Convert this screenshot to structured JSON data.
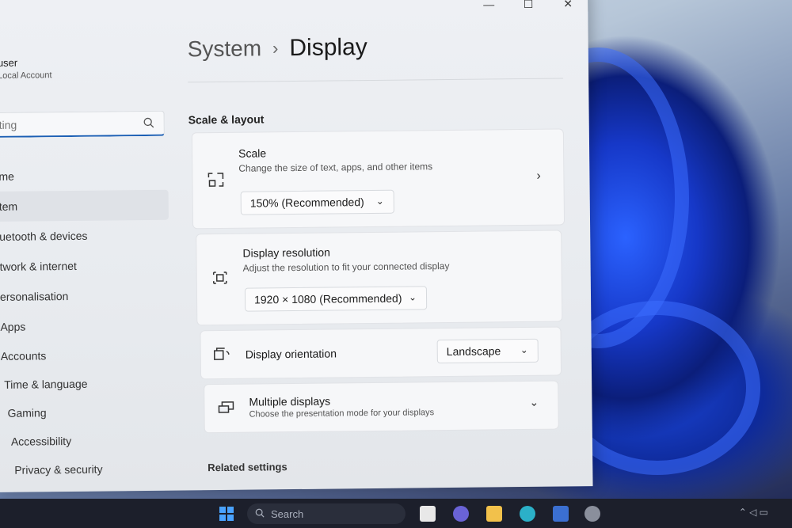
{
  "window": {
    "controls": {
      "minimize": "—",
      "maximize": "☐",
      "close": "✕"
    }
  },
  "user": {
    "name": "user",
    "account_type": "Local Account"
  },
  "search": {
    "placeholder": "ting"
  },
  "sidebar": {
    "items": [
      {
        "label": "me",
        "active": false
      },
      {
        "label": "tem",
        "active": true
      },
      {
        "label": "uetooth & devices",
        "active": false
      },
      {
        "label": "twork & internet",
        "active": false
      },
      {
        "label": "ersonalisation",
        "active": false
      },
      {
        "label": "Apps",
        "active": false
      },
      {
        "label": "Accounts",
        "active": false
      },
      {
        "label": "Time & language",
        "active": false
      },
      {
        "label": "Gaming",
        "active": false
      },
      {
        "label": "Accessibility",
        "active": false
      },
      {
        "label": "Privacy & security",
        "active": false
      }
    ]
  },
  "breadcrumb": {
    "parent": "System",
    "separator": "›",
    "current": "Display"
  },
  "section": {
    "title": "Scale & layout"
  },
  "scale": {
    "title": "Scale",
    "description": "Change the size of text, apps, and other items",
    "value": "150% (Recommended)"
  },
  "resolution": {
    "title": "Display resolution",
    "description": "Adjust the resolution to fit your connected display",
    "value": "1920 × 1080 (Recommended)"
  },
  "orientation": {
    "title": "Display orientation",
    "value": "Landscape"
  },
  "multiple": {
    "title": "Multiple displays",
    "description": "Choose the presentation mode for your displays"
  },
  "related": {
    "title": "Related settings"
  },
  "taskbar": {
    "search_label": "Search"
  },
  "colors": {
    "accent": "#1b5fb4",
    "wallpaper_blue": "#1638c8"
  }
}
